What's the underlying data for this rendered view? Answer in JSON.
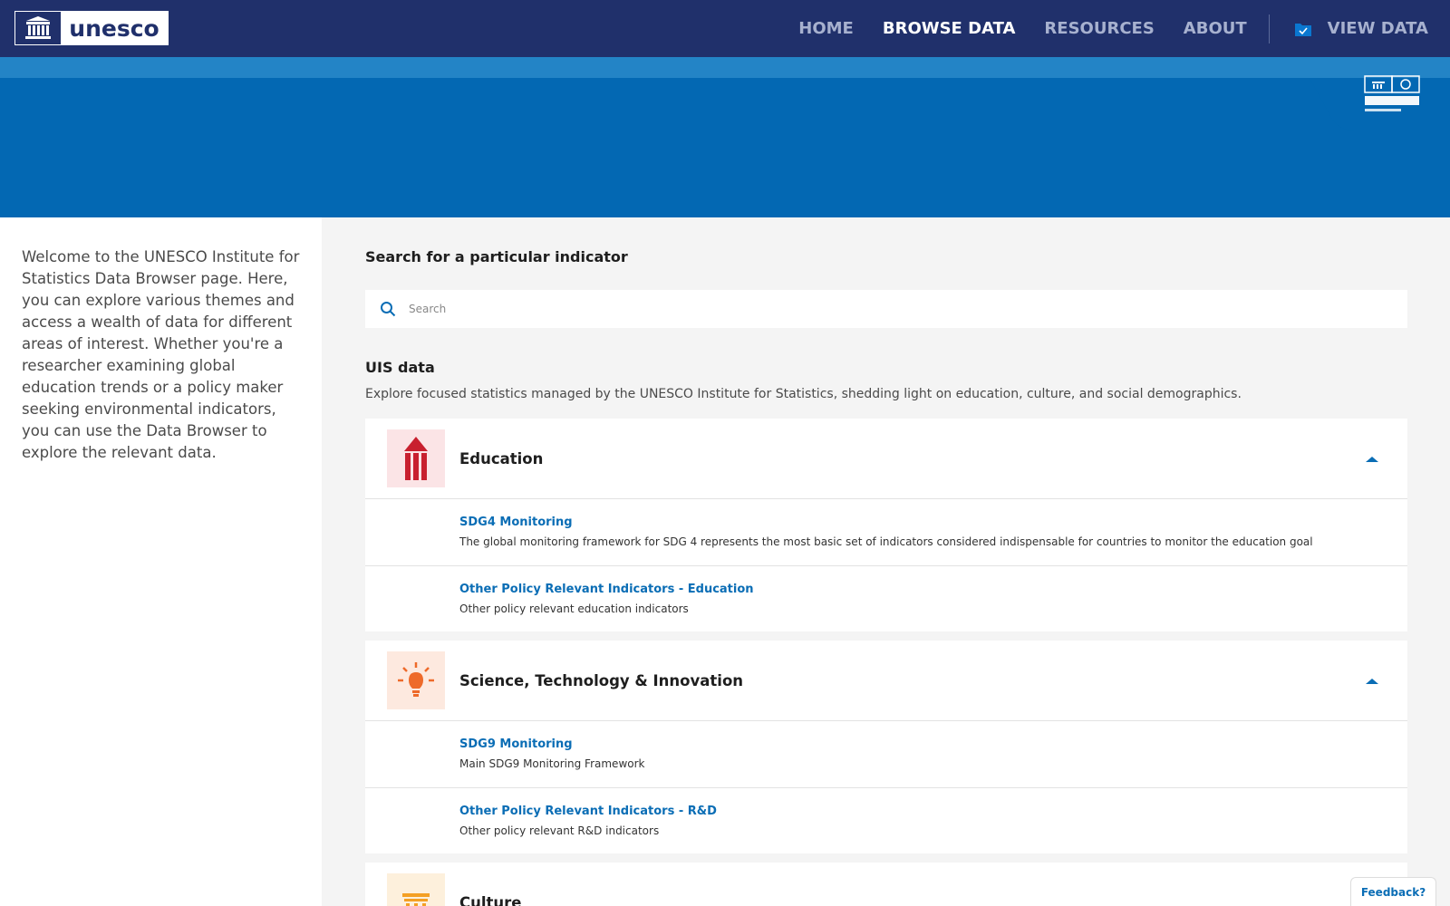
{
  "nav": {
    "logo_text": "unesco",
    "items": [
      {
        "label": "HOME"
      },
      {
        "label": "BROWSE DATA"
      },
      {
        "label": "RESOURCES"
      },
      {
        "label": "ABOUT"
      }
    ],
    "view_data_label": "VIEW DATA"
  },
  "intro": {
    "text": "Welcome to the UNESCO Institute for Statistics Data Browser page. Here, you can explore various themes and access a wealth of data for different areas of interest. Whether you're a researcher examining global education trends or a policy maker seeking environmental indicators, you can use the Data Browser to explore the relevant data."
  },
  "search": {
    "label": "Search for a particular indicator",
    "placeholder": "Search",
    "value": ""
  },
  "uis": {
    "title": "UIS data",
    "description": "Explore focused statistics managed by the UNESCO Institute for Statistics, shedding light on education, culture, and social demographics."
  },
  "sections": [
    {
      "title": "Education",
      "icon": "pencil-icon",
      "subs": [
        {
          "title": "SDG4 Monitoring",
          "desc": "The global monitoring framework for SDG 4 represents the most basic set of indicators considered indispensable for countries to monitor the education goal"
        },
        {
          "title": "Other Policy Relevant Indicators - Education",
          "desc": "Other policy relevant education indicators"
        }
      ]
    },
    {
      "title": "Science, Technology & Innovation",
      "icon": "lightbulb-icon",
      "subs": [
        {
          "title": "SDG9 Monitoring",
          "desc": "Main SDG9 Monitoring Framework"
        },
        {
          "title": "Other Policy Relevant Indicators - R&D",
          "desc": "Other policy relevant R&D indicators"
        }
      ]
    },
    {
      "title": "Culture",
      "icon": "temple-icon",
      "subs": []
    }
  ],
  "feedback_label": "Feedback?",
  "colors": {
    "nav_bg": "#20306b",
    "banner": "#0368b3",
    "link": "#0a6db5",
    "education_icon": "#c8202f",
    "science_icon": "#ee6a2a",
    "culture_icon": "#f4a024"
  }
}
